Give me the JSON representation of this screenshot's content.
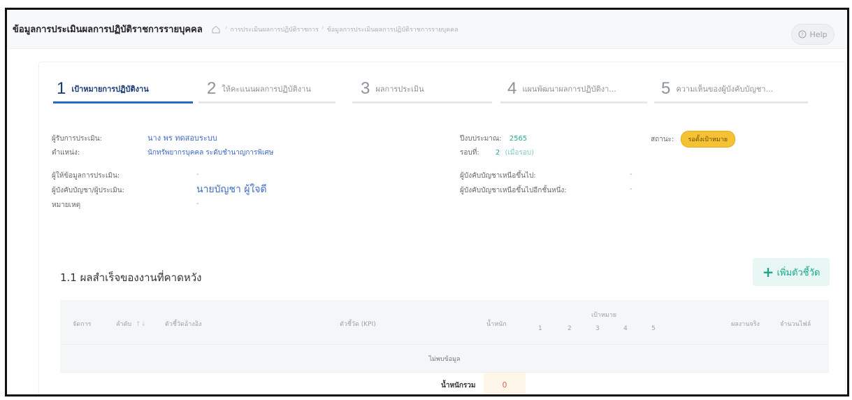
{
  "header": {
    "title": "ข้อมูลการประเมินผลการปฏิบัติราชการรายบุคคล",
    "breadcrumbs": [
      "การประเมินผลการปฏิบัติราชการ",
      "ข้อมูลการประเมินผลการปฏิบัติราชการรายบุคคล"
    ],
    "help_label": "Help"
  },
  "steps": [
    {
      "num": "1",
      "label": "เป้าหมายการปฏิบัติงาน",
      "active": true
    },
    {
      "num": "2",
      "label": "ให้คะแนนผลการปฏิบัติงาน",
      "active": false
    },
    {
      "num": "3",
      "label": "ผลการประเมิน",
      "active": false
    },
    {
      "num": "4",
      "label": "แผนพัฒนาผลการปฏิบัติงา...",
      "active": false
    },
    {
      "num": "5",
      "label": "ความเห็นของผู้บังคับบัญชา...",
      "active": false
    }
  ],
  "info": {
    "assessee_label": "ผู้รับการประเมิน:",
    "assessee_value": "นาง พร ทดสอบระบบ",
    "position_label": "ตำแหน่ง:",
    "position_value": "นักทรัพยากรบุคคล  ระดับชำนาญการพิเศษ",
    "informant_label": "ผู้ให้ข้อมูลการประเมิน:",
    "informant_value": "-",
    "supervisor_label": "ผู้บังคับบัญชา/ผู้ประเมิน:",
    "supervisor_value": "นายบัญชา  ผู้ใจดี",
    "note_label": "หมายเหตุ",
    "note_value": "-",
    "budget_year_label": "ปีงบประมาณ:",
    "budget_year_value": "2565",
    "round_label": "รอบที่:",
    "round_value": "2",
    "round_note": "(เมื่อรอบ)",
    "upper_supervisor_label": "ผู้บังคับบัญชาเหนือขึ้นไป:",
    "upper_supervisor_value": "-",
    "upper_supervisor2_label": "ผู้บังคับบัญชาเหนือขึ้นไปอีกชั้นหนึ่ง:",
    "upper_supervisor2_value": "-",
    "status_label": "สถานะ:",
    "status_value": "รอตั้งเป้าหมาย"
  },
  "section": {
    "title": "1.1 ผลสำเร็จของงานที่คาดหวัง",
    "add_label": "เพิ่มตัวชี้วัด"
  },
  "table": {
    "headers": {
      "manage": "จัดการ",
      "order": "ลำดับ",
      "reference_kpi": "ตัวชี้วัดอ้างอิง",
      "kpi": "ตัวชี้วัด (KPI)",
      "weight": "น้ำหนัก",
      "target": "เป้าหมาย",
      "t1": "1",
      "t2": "2",
      "t3": "3",
      "t4": "4",
      "t5": "5",
      "actual": "ผลงานจริง",
      "files": "จำนวนไฟล์"
    },
    "empty_text": "ไม่พบข้อมูล",
    "total_label": "น้ำหนักรวม",
    "total_value": "0"
  },
  "colors": {
    "accent": "#2a67c8",
    "active_step": "#1a3a73",
    "status_badge": "#f5c233",
    "add_button": "#18a589",
    "total_value": "#e0614d"
  }
}
